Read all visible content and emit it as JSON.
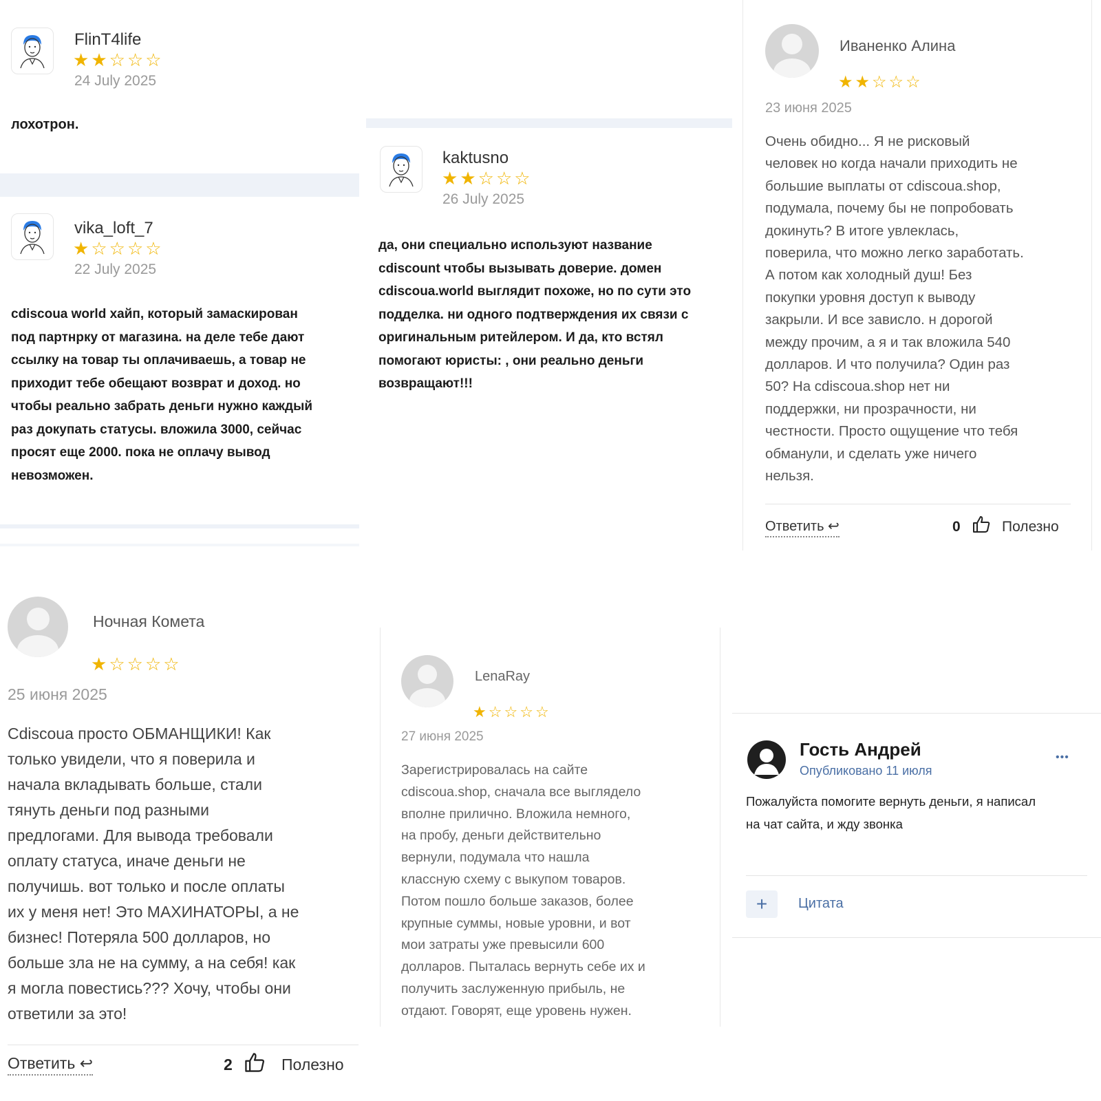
{
  "reviews": {
    "flint": {
      "author": "FlinT4life",
      "rating": 2,
      "max_rating": 5,
      "date": "24 July 2025",
      "text": "лохотрон."
    },
    "vika": {
      "author": "vika_loft_7",
      "rating": 1,
      "max_rating": 5,
      "date": "22 July 2025",
      "text": "cdiscoua world хайп, который замаскирован\nпод партнрку от магазина. на деле тебе дают\nссылку на товар ты оплачиваешь, а товар не\nприходит тебе обещают возврат и доход. но\nчтобы реально забрать деньги нужно каждый\nраз докупать статусы. вложила 3000, сейчас\nпросят еще 2000. пока не оплачу вывод\nневозможен."
    },
    "kaktusno": {
      "author": "kaktusno",
      "rating": 2,
      "max_rating": 5,
      "date": "26 July 2025",
      "text": "да, они специально используют название\ncdiscount чтобы вызывать доверие. домен\ncdiscoua.world выглядит похоже, но по сути это\nподделка. ни одного подтверждения их связи с\nоригинальным ритейлером. И да, кто встял\nпомогают юристы: , они реально деньги\nвозвращают!!!"
    },
    "alina": {
      "author": "Иваненко Алина",
      "rating": 2,
      "max_rating": 5,
      "date": "23 июня 2025",
      "text": "Очень обидно... Я не рисковый\nчеловек но когда начали приходить не\nбольшие выплаты от cdiscoua.shop,\nподумала, почему бы не попробовать\nдокинуть? В итоге увлеклась,\nповерила, что можно легко заработать.\nА потом как холодный душ! Без\nпокупки уровня доступ к выводу\nзакрыли. И все зависло. н дорогой\nмежду прочим, а я и так вложила 540\nдолларов. И что получила? Один раз\n50? На cdiscoua.shop нет ни\nподдержки, ни прозрачности, ни\nчестности. Просто ощущение что тебя\nобманули, и сделать уже ничего\nнельзя.",
      "reply_label": "Ответить ↩",
      "helpful_count": "0",
      "helpful_label": "Полезно"
    },
    "kometa": {
      "author": "Ночная Комета",
      "rating": 1,
      "max_rating": 5,
      "date": "25 июня 2025",
      "text": "Cdiscoua просто ОБМАНЩИКИ! Как\nтолько увидели, что я поверила и\nначала вкладывать больше, стали\nтянуть деньги под разными\nпредлогами. Для вывода требовали\nоплату статуса, иначе деньги не\nполучишь. вот только и после оплаты\nих у меня нет! Это МАХИНАТОРЫ, а не\nбизнес! Потеряла 500 долларов, но\nбольше зла не на сумму, а на себя! как\nя могла повестись??? Хочу, чтобы они\nответили за это!",
      "reply_label": "Ответить ↩",
      "helpful_count": "2",
      "helpful_label": "Полезно"
    },
    "lenaray": {
      "author": "LenaRay",
      "rating": 1,
      "max_rating": 5,
      "date": "27 июня 2025",
      "text": "Зарегистрировалась на сайте\ncdiscoua.shop, сначала все выглядело\nвполне прилично. Вложила немного,\nна пробу, деньги действительно\nвернули, подумала что нашла\nклассную схему с выкупом товаров.\nПотом пошло больше заказов, более\nкрупные суммы, новые уровни, и вот\nмои затраты уже превысили 600\nдолларов. Пыталась вернуть себе их и\nполучить заслуженную прибыль, не\nотдают. Говорят, еще уровень нужен."
    },
    "andrey": {
      "author": "Гость Андрей",
      "published": "Опубликовано 11 июля",
      "more": "•••",
      "text": "Пожалуйста помогите вернуть деньги, я написал\nна чат сайта, и жду звонка",
      "plus": "+",
      "quote_label": "Цитата"
    }
  },
  "colors": {
    "star": "#f0b400",
    "band": "#eef2f8",
    "link_blue": "#4a6fa5",
    "date_gray": "#9a9a9a"
  }
}
